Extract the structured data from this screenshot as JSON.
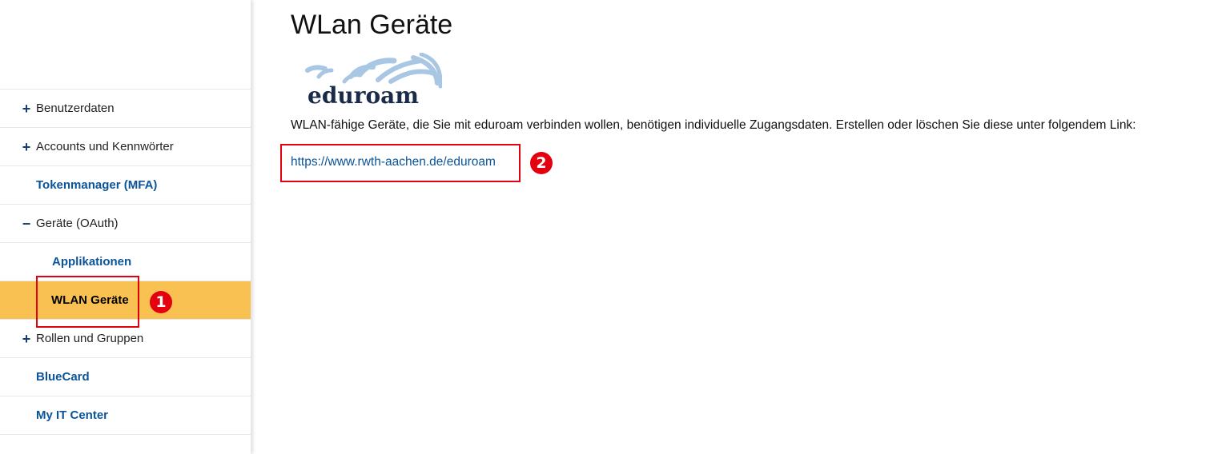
{
  "sidebar": {
    "items": [
      {
        "sign": "+",
        "label": "Benutzerdaten"
      },
      {
        "sign": "+",
        "label": "Accounts und Kennwörter"
      },
      {
        "label": "Tokenmanager (MFA)"
      },
      {
        "sign": "−",
        "label": "Geräte (OAuth)"
      },
      {
        "label": "Applikationen"
      },
      {
        "label": "WLAN Geräte"
      },
      {
        "sign": "+",
        "label": "Rollen und Gruppen"
      },
      {
        "label": "BlueCard"
      },
      {
        "label": "My IT Center"
      }
    ]
  },
  "annotations": {
    "one": "1",
    "two": "2"
  },
  "main": {
    "title": "WLan Geräte",
    "logo_text": "eduroam",
    "description": "WLAN-fähige Geräte, die Sie mit eduroam verbinden wollen, benötigen individuelle Zugangsdaten. Erstellen oder löschen Sie diese unter folgendem Link:",
    "link": "https://www.rwth-aachen.de/eduroam"
  },
  "colors": {
    "active_bg": "#f9c152",
    "link": "#0b5499",
    "annotation": "#e3000f"
  }
}
